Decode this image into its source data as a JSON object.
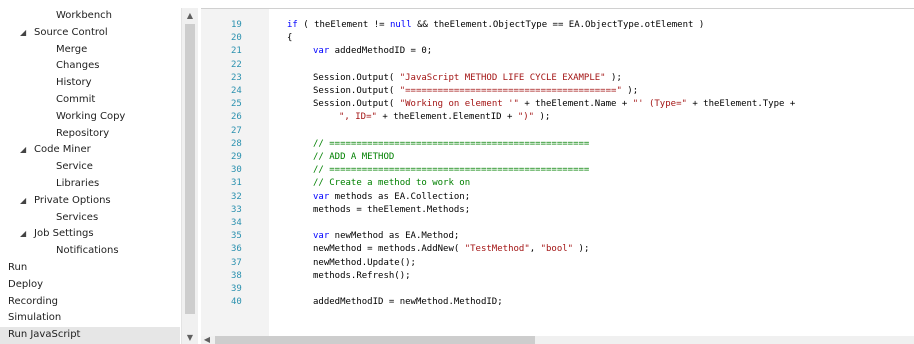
{
  "sidebar": {
    "items": [
      {
        "label": "Workbench",
        "level": 1
      },
      {
        "label": "Source Control",
        "level": 0,
        "group": true
      },
      {
        "label": "Merge",
        "level": 1
      },
      {
        "label": "Changes",
        "level": 1
      },
      {
        "label": "History",
        "level": 1
      },
      {
        "label": "Commit",
        "level": 1
      },
      {
        "label": "Working Copy",
        "level": 1
      },
      {
        "label": "Repository",
        "level": 1
      },
      {
        "label": "Code Miner",
        "level": 0,
        "group": true
      },
      {
        "label": "Service",
        "level": 1
      },
      {
        "label": "Libraries",
        "level": 1
      },
      {
        "label": "Private Options",
        "level": 0,
        "group": true
      },
      {
        "label": "Services",
        "level": 1
      },
      {
        "label": "Job Settings",
        "level": 0,
        "group": true
      },
      {
        "label": "Notifications",
        "level": 1
      },
      {
        "label": "Run",
        "level": 0
      },
      {
        "label": "Deploy",
        "level": 0
      },
      {
        "label": "Recording",
        "level": 0
      },
      {
        "label": "Simulation",
        "level": 0
      },
      {
        "label": "Run JavaScript",
        "level": 0,
        "selected": true
      }
    ],
    "expand_icon": "triangle-down-icon"
  },
  "editor": {
    "lines": [
      {
        "n": "19",
        "indent": 0,
        "parts": [
          [
            "kw",
            "if"
          ],
          [
            "t",
            " ( theElement != "
          ],
          [
            "kw",
            "null"
          ],
          [
            "t",
            " && theElement.ObjectType == EA.ObjectType.otElement )"
          ]
        ]
      },
      {
        "n": "20",
        "indent": 0,
        "parts": [
          [
            "t",
            "{"
          ]
        ]
      },
      {
        "n": "21",
        "indent": 1,
        "parts": [
          [
            "kw",
            "var"
          ],
          [
            "t",
            " addedMethodID = 0;"
          ]
        ]
      },
      {
        "n": "22",
        "indent": 1,
        "parts": []
      },
      {
        "n": "23",
        "indent": 1,
        "parts": [
          [
            "t",
            "Session.Output( "
          ],
          [
            "str",
            "\"JavaScript METHOD LIFE CYCLE EXAMPLE\""
          ],
          [
            "t",
            " );"
          ]
        ]
      },
      {
        "n": "24",
        "indent": 1,
        "parts": [
          [
            "t",
            "Session.Output( "
          ],
          [
            "str",
            "\"=======================================\""
          ],
          [
            "t",
            " );"
          ]
        ]
      },
      {
        "n": "25",
        "indent": 1,
        "parts": [
          [
            "t",
            "Session.Output( "
          ],
          [
            "str",
            "\"Working on element '\""
          ],
          [
            "t",
            " + theElement.Name + "
          ],
          [
            "str",
            "\"' (Type=\""
          ],
          [
            "t",
            " + theElement.Type +"
          ]
        ]
      },
      {
        "n": "26",
        "indent": 2,
        "parts": [
          [
            "str",
            "\", ID=\""
          ],
          [
            "t",
            " + theElement.ElementID + "
          ],
          [
            "str",
            "\")\""
          ],
          [
            "t",
            " );"
          ]
        ]
      },
      {
        "n": "27",
        "indent": 1,
        "parts": []
      },
      {
        "n": "28",
        "indent": 1,
        "parts": [
          [
            "cmt",
            "// ================================================"
          ]
        ]
      },
      {
        "n": "29",
        "indent": 1,
        "parts": [
          [
            "cmt",
            "// ADD A METHOD"
          ]
        ]
      },
      {
        "n": "30",
        "indent": 1,
        "parts": [
          [
            "cmt",
            "// ================================================"
          ]
        ]
      },
      {
        "n": "31",
        "indent": 1,
        "parts": [
          [
            "cmt",
            "// Create a method to work on"
          ]
        ]
      },
      {
        "n": "32",
        "indent": 1,
        "parts": [
          [
            "kw",
            "var"
          ],
          [
            "t",
            " methods as EA.Collection;"
          ]
        ]
      },
      {
        "n": "33",
        "indent": 1,
        "parts": [
          [
            "t",
            "methods = theElement.Methods;"
          ]
        ]
      },
      {
        "n": "34",
        "indent": 1,
        "parts": []
      },
      {
        "n": "35",
        "indent": 1,
        "parts": [
          [
            "kw",
            "var"
          ],
          [
            "t",
            " newMethod as EA.Method;"
          ]
        ]
      },
      {
        "n": "36",
        "indent": 1,
        "parts": [
          [
            "t",
            "newMethod = methods.AddNew( "
          ],
          [
            "str",
            "\"TestMethod\""
          ],
          [
            "t",
            ", "
          ],
          [
            "str",
            "\"bool\""
          ],
          [
            "t",
            " );"
          ]
        ]
      },
      {
        "n": "37",
        "indent": 1,
        "parts": [
          [
            "t",
            "newMethod.Update();"
          ]
        ]
      },
      {
        "n": "38",
        "indent": 1,
        "parts": [
          [
            "t",
            "methods.Refresh();"
          ]
        ]
      },
      {
        "n": "39",
        "indent": 1,
        "parts": []
      },
      {
        "n": "40",
        "indent": 1,
        "parts": [
          [
            "t",
            "addedMethodID = newMethod.MethodID;"
          ]
        ]
      }
    ]
  },
  "colors": {
    "keyword": "#0000ff",
    "string": "#a31515",
    "comment": "#008000",
    "line_number": "#2b91af"
  },
  "icons": {
    "scroll_up": "scroll-up-arrow-icon",
    "scroll_down": "scroll-down-arrow-icon",
    "scroll_left": "scroll-left-arrow-icon"
  }
}
